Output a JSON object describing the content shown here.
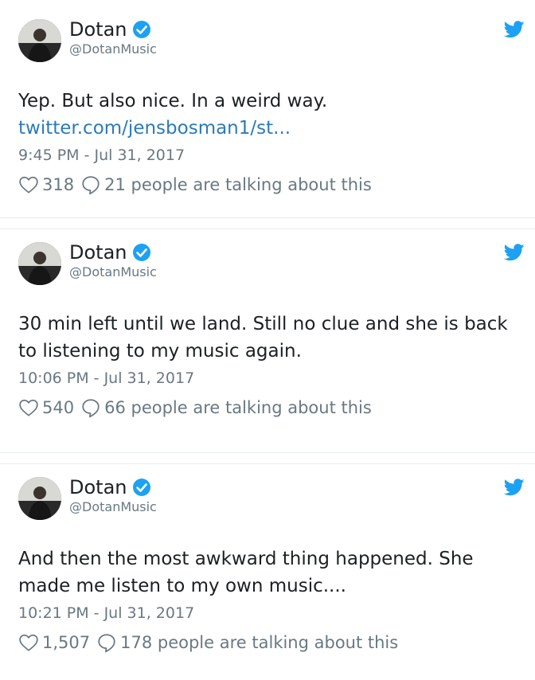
{
  "colors": {
    "link": "#2b7bb9",
    "verified": "#1da1f2",
    "muted": "#697882",
    "text": "#1c2022",
    "divider": "#e6ecf0"
  },
  "tweets": [
    {
      "name": "Dotan",
      "handle": "@DotanMusic",
      "text": "Yep. But also nice. In a weird way.",
      "link": "twitter.com/jensbosman1/st...",
      "timestamp": "9:45 PM - Jul 31, 2017",
      "likes": "318",
      "talking": "21 people are talking about this"
    },
    {
      "name": "Dotan",
      "handle": "@DotanMusic",
      "text": "30 min left until we land. Still no clue and she is back to listening to my music again.",
      "timestamp": "10:06 PM - Jul 31, 2017",
      "likes": "540",
      "talking": "66 people are talking about this"
    },
    {
      "name": "Dotan",
      "handle": "@DotanMusic",
      "text": "And then the most awkward thing happened. She made me listen to my own music....",
      "timestamp": "10:21 PM - Jul 31, 2017",
      "likes": "1,507",
      "talking": "178 people are talking about this"
    }
  ]
}
